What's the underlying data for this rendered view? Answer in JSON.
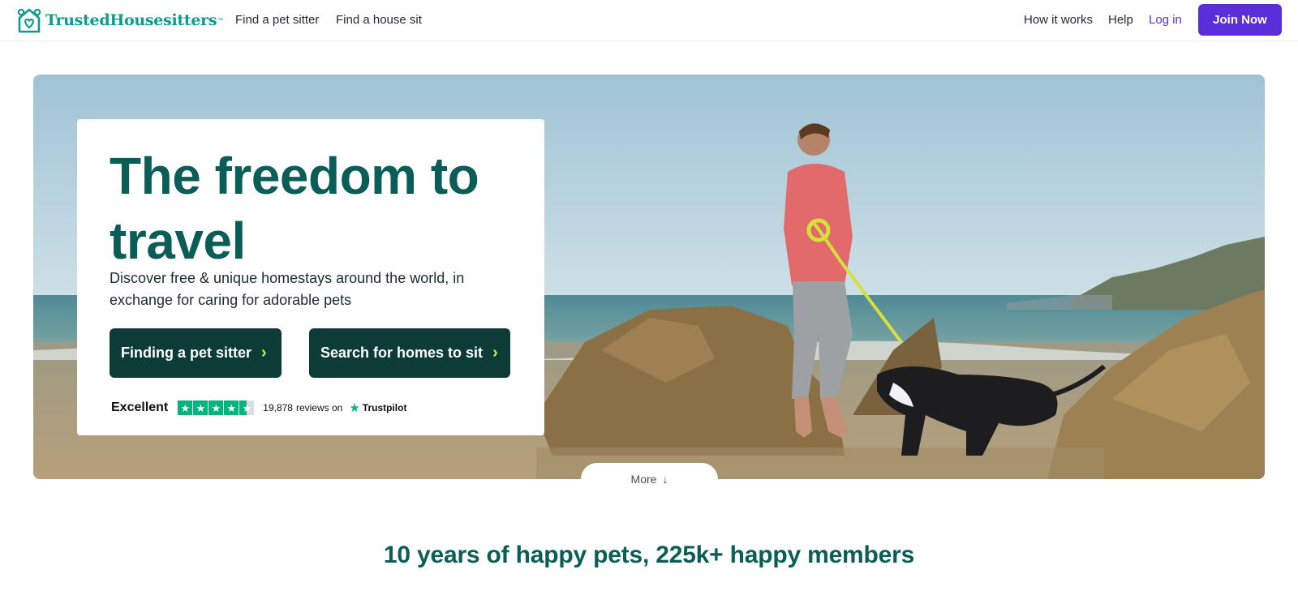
{
  "header": {
    "brand": "TrustedHousesitters",
    "brand_tm": "™",
    "nav": [
      {
        "label": "Find a pet sitter"
      },
      {
        "label": "Find a house sit"
      }
    ],
    "right_nav": [
      {
        "label": "How it works"
      },
      {
        "label": "Help"
      }
    ],
    "login_label": "Log in",
    "join_label": "Join Now"
  },
  "hero": {
    "title": "The freedom to travel",
    "subtitle": "Discover free & unique homestays around the world, in exchange for caring for adorable pets",
    "cta_primary": "Finding a pet sitter",
    "cta_secondary": "Search for homes to sit",
    "trustpilot": {
      "rating_word": "Excellent",
      "stars": 4.5,
      "review_count": "19,878",
      "reviews_on": "reviews on",
      "brand": "Trustpilot"
    },
    "more_label": "More"
  },
  "stats": {
    "tagline": "10 years of happy pets, 225k+ happy members"
  },
  "colors": {
    "brand_teal": "#0d9b8f",
    "heading_teal": "#0b5d57",
    "cta_dark": "#0c3b38",
    "join_purple": "#5a2fd9",
    "trustpilot_green": "#00b67a"
  }
}
